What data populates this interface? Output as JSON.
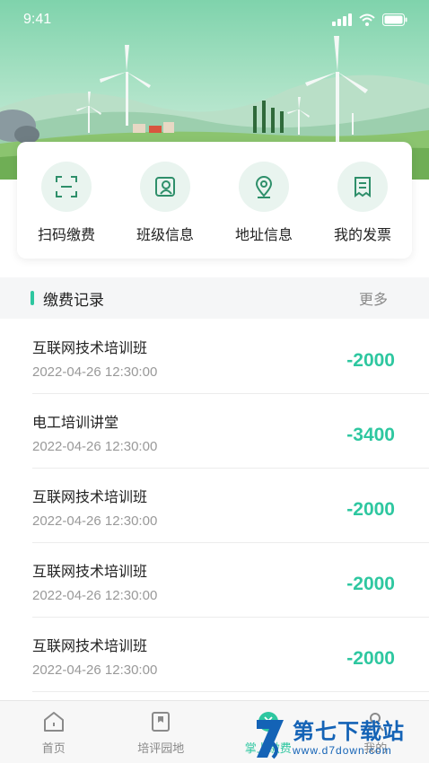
{
  "status": {
    "time": "9:41"
  },
  "quick_actions": [
    {
      "label": "扫码缴费",
      "icon": "scan-icon"
    },
    {
      "label": "班级信息",
      "icon": "class-card-icon"
    },
    {
      "label": "地址信息",
      "icon": "location-pin-icon"
    },
    {
      "label": "我的发票",
      "icon": "invoice-icon"
    }
  ],
  "records_section": {
    "title": "缴费记录",
    "more": "更多"
  },
  "records": [
    {
      "title": "互联网技术培训班",
      "time": "2022-04-26  12:30:00",
      "amount": "-2000"
    },
    {
      "title": "电工培训讲堂",
      "time": "2022-04-26  12:30:00",
      "amount": "-3400"
    },
    {
      "title": "互联网技术培训班",
      "time": "2022-04-26  12:30:00",
      "amount": "-2000"
    },
    {
      "title": "互联网技术培训班",
      "time": "2022-04-26  12:30:00",
      "amount": "-2000"
    },
    {
      "title": "互联网技术培训班",
      "time": "2022-04-26  12:30:00",
      "amount": "-2000"
    }
  ],
  "tabbar": [
    {
      "label": "首页",
      "icon": "home-icon"
    },
    {
      "label": "培评园地",
      "icon": "bookmark-icon"
    },
    {
      "label": "掌上缴费",
      "icon": "pay-icon"
    },
    {
      "label": "我的",
      "icon": "user-icon"
    }
  ],
  "watermark": {
    "text": "第七下载站",
    "url": "www.d7down.com"
  },
  "colors": {
    "accent": "#2ec7a0",
    "icon_bg": "#e9f4ef",
    "watermark": "#1463b6"
  }
}
